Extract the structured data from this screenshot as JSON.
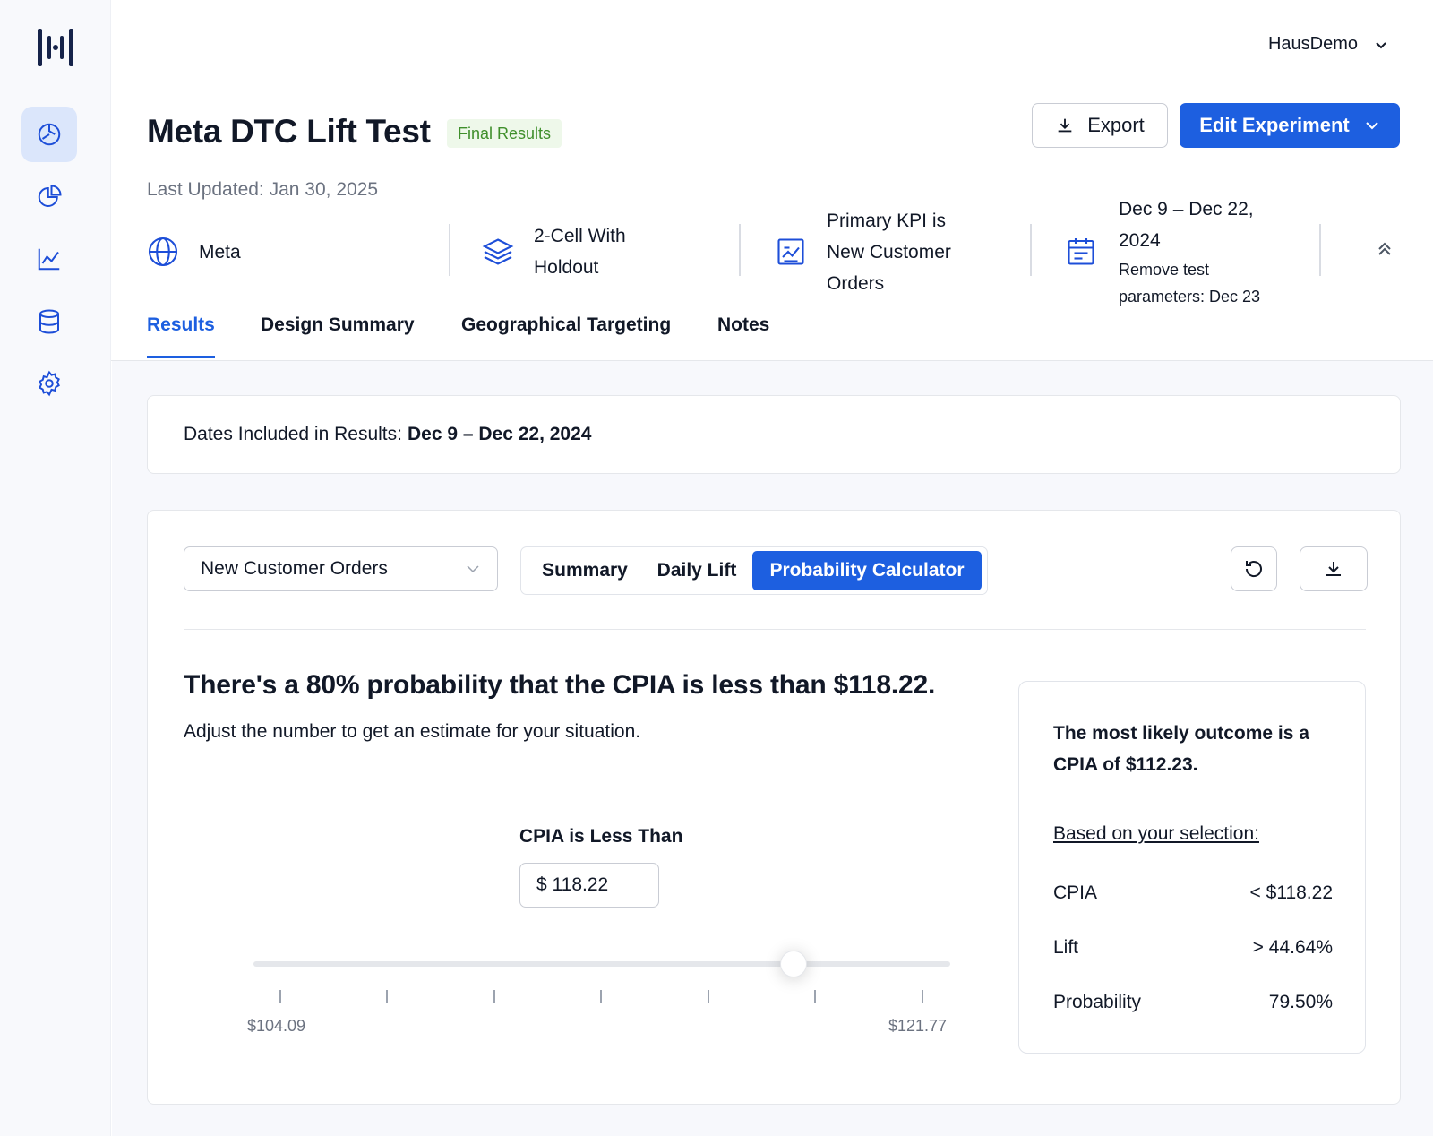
{
  "account": {
    "name": "HausDemo",
    "chevron_icon": "chevron-down-icon"
  },
  "sidebar": {
    "items": [
      {
        "name": "dashboard",
        "icon": "chart-compass-icon",
        "active": true
      },
      {
        "name": "reports",
        "icon": "pie-chart-icon",
        "active": false
      },
      {
        "name": "analytics",
        "icon": "line-chart-icon",
        "active": false
      },
      {
        "name": "data",
        "icon": "database-icon",
        "active": false
      },
      {
        "name": "settings",
        "icon": "gear-icon",
        "active": false
      }
    ]
  },
  "header": {
    "title": "Meta DTC Lift Test",
    "badge": "Final Results",
    "export_label": "Export",
    "edit_label": "Edit Experiment",
    "last_updated": "Last Updated: Jan 30, 2025"
  },
  "meta": {
    "channel": "Meta",
    "design_line1": "2-Cell With",
    "design_line2": "Holdout",
    "kpi_line1": "Primary KPI is",
    "kpi_line2": "New Customer",
    "kpi_line3": "Orders",
    "dates_line1": "Dec 9 – Dec 22,",
    "dates_line2": "2024",
    "remove_line1": "Remove test",
    "remove_line2": "parameters: Dec 23"
  },
  "tabs": [
    {
      "label": "Results",
      "active": true
    },
    {
      "label": "Design Summary",
      "active": false
    },
    {
      "label": "Geographical Targeting",
      "active": false
    },
    {
      "label": "Notes",
      "active": false
    }
  ],
  "dates_included": {
    "label": "Dates Included in Results:",
    "value": "Dec 9 – Dec 22, 2024"
  },
  "controls": {
    "metric_select": "New Customer Orders",
    "views": [
      {
        "label": "Summary",
        "active": false
      },
      {
        "label": "Daily Lift",
        "active": false
      },
      {
        "label": "Probability Calculator",
        "active": true
      }
    ]
  },
  "calculator": {
    "headline": "There's a 80% probability that the CPIA is less than $118.22.",
    "subline": "Adjust the number to get an estimate for your situation.",
    "input_label": "CPIA is Less Than",
    "input_value": "$ 118.22",
    "slider": {
      "min_label": "$104.09",
      "max_label": "$121.77",
      "min": 104.09,
      "max": 121.77,
      "value": 118.22
    }
  },
  "outcome": {
    "title": "The most likely outcome is a CPIA of $112.23.",
    "selection_label": "Based on your selection:",
    "rows": [
      {
        "label": "CPIA",
        "value": "< $118.22"
      },
      {
        "label": "Lift",
        "value": "> 44.64%"
      },
      {
        "label": "Probability",
        "value": "79.50%"
      }
    ]
  },
  "colors": {
    "primary": "#1d5fe0",
    "badge_bg": "#eef8ea",
    "badge_text": "#3f8f2b"
  }
}
